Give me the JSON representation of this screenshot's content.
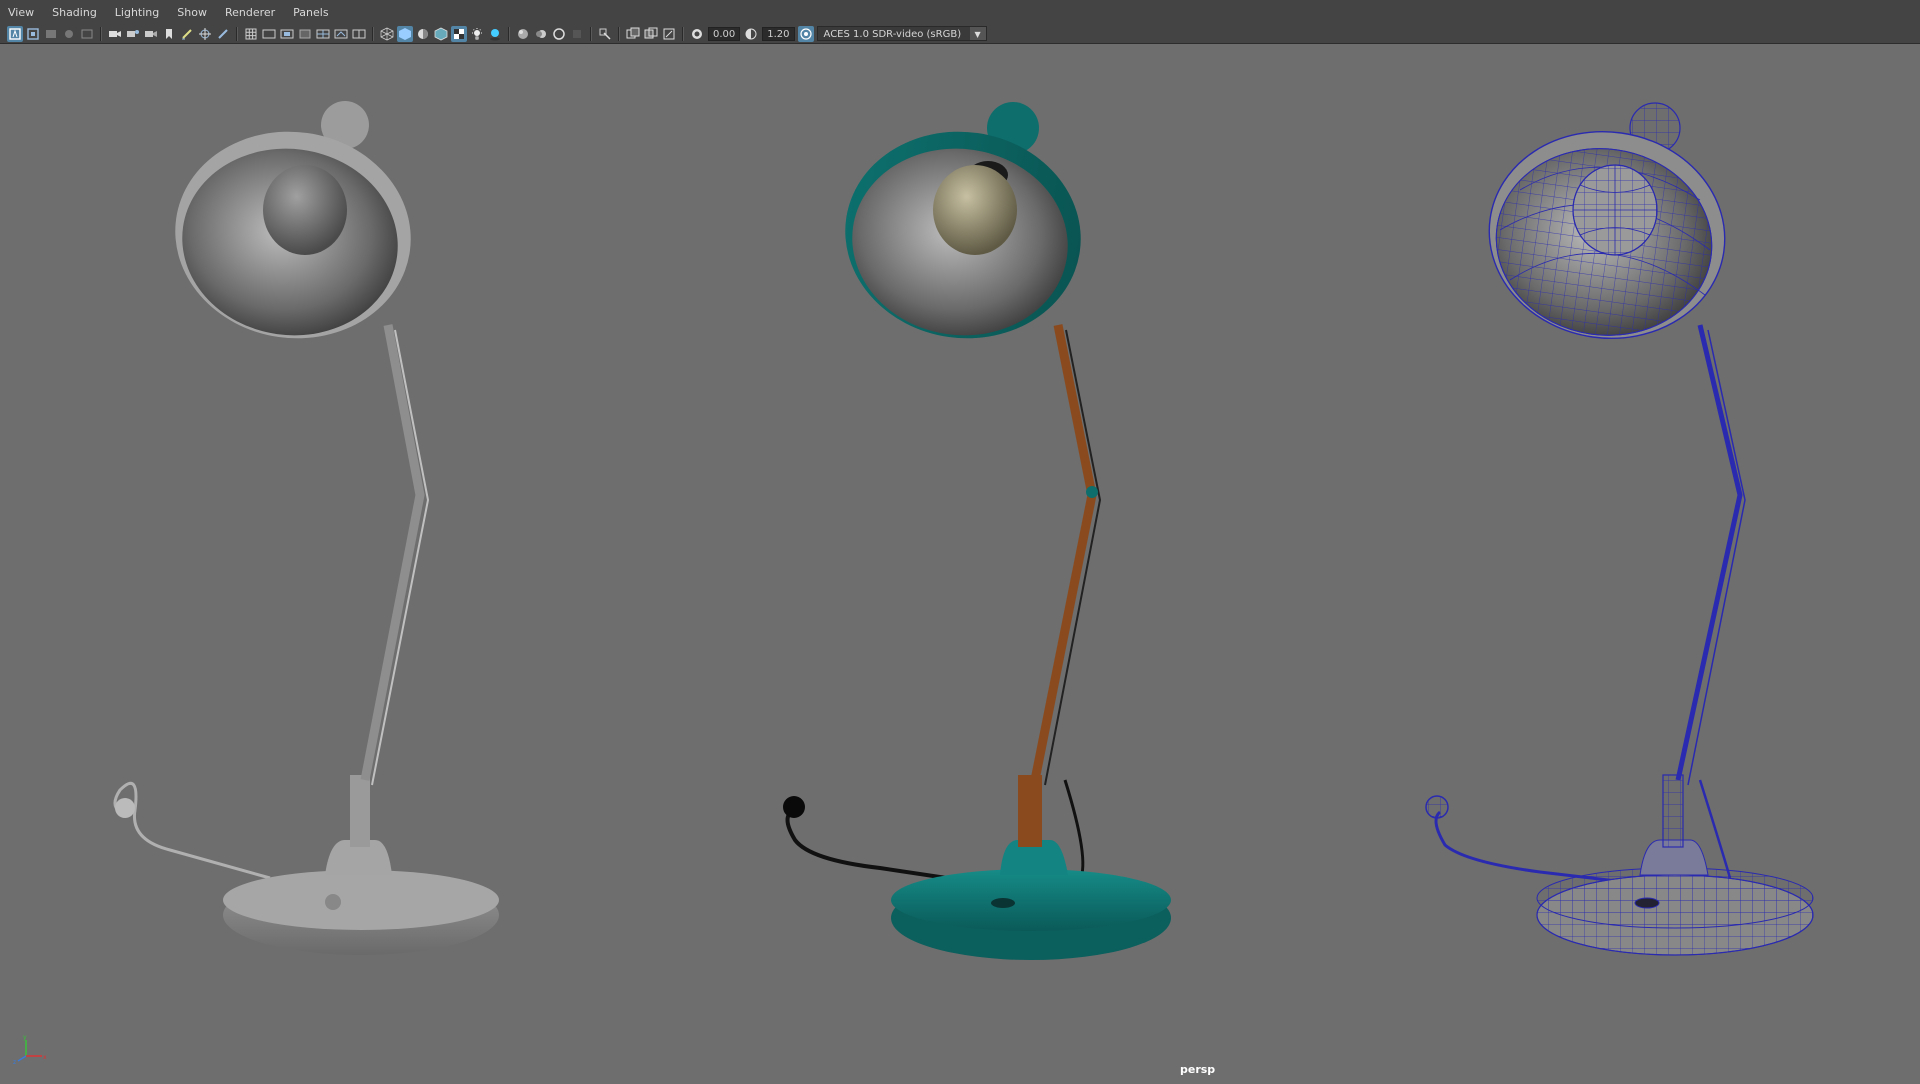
{
  "menu": [
    "View",
    "Shading",
    "Lighting",
    "Show",
    "Renderer",
    "Panels"
  ],
  "toolbar": {
    "exposure_value": "0.00",
    "gamma_value": "1.20",
    "color_space": "ACES 1.0 SDR-video (sRGB)",
    "icons": [
      "select-camera-icon",
      "camera-attributes-icon",
      "bookmark-icon",
      "image-plane-icon",
      "film-gate-icon",
      "grid-icon",
      "wireframe-icon",
      "smooth-shade-icon",
      "textured-icon",
      "lights-icon",
      "shadows-icon",
      "ambient-occlusion-icon",
      "isolate-select-icon",
      "xray-icon",
      "exposure-icon",
      "gamma-icon",
      "color-management-icon"
    ]
  },
  "viewport": {
    "camera": "persp",
    "background_color": "#6e6e6e",
    "lamp_colors": {
      "shaded_gray": "#8a8a8a",
      "textured_teal": "#0f7a78",
      "textured_wood": "#8b4a1e",
      "wireframe_blue": "#2a2ab0"
    },
    "axis_labels": {
      "x": "x",
      "y": "y",
      "z": "z"
    }
  }
}
